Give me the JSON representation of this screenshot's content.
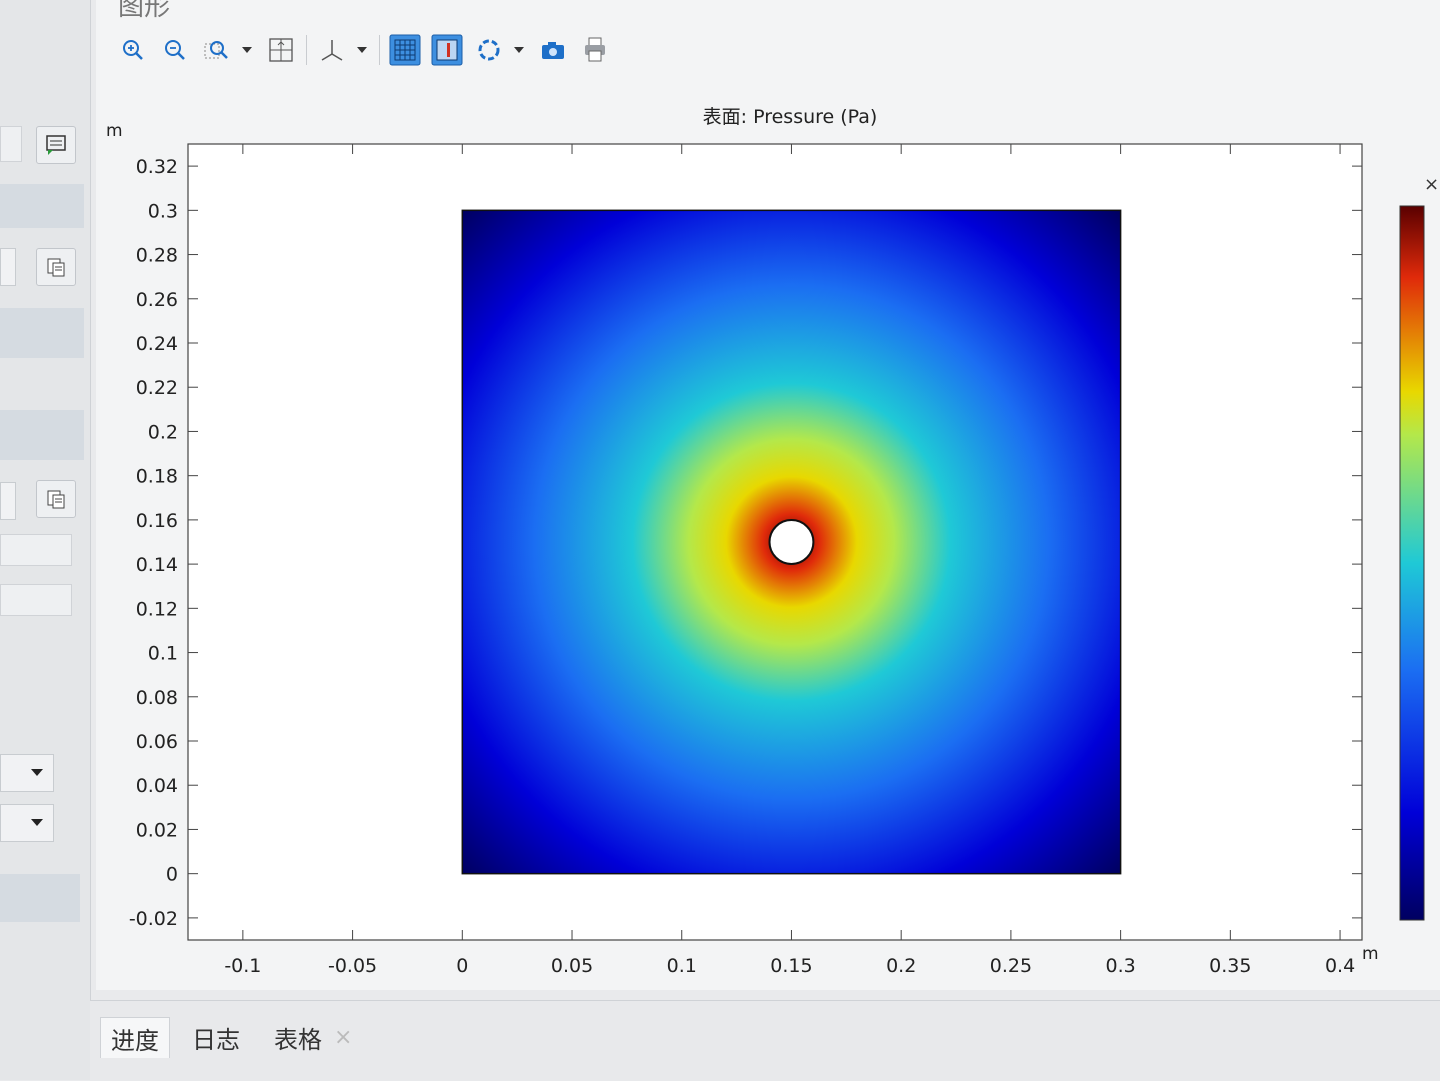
{
  "window": {
    "title": "图形"
  },
  "toolbar": {
    "icons": [
      "zoom-in-icon",
      "zoom-out-icon",
      "zoom-box-icon",
      "zoom-extents-icon",
      "axis-icon",
      "grid-icon",
      "colorbar-icon",
      "rotate-icon",
      "camera-icon",
      "print-icon"
    ]
  },
  "plot": {
    "title": "表面: Pressure (Pa)",
    "close_glyph": "×"
  },
  "chart_data": {
    "type": "heatmap",
    "title": "表面: Pressure (Pa)",
    "xlabel": "m",
    "ylabel": "m",
    "x_ticks": [
      "-0.1",
      "-0.05",
      "0",
      "0.05",
      "0.1",
      "0.15",
      "0.2",
      "0.25",
      "0.3",
      "0.35",
      "0.4"
    ],
    "y_ticks": [
      "0.32",
      "0.3",
      "0.28",
      "0.26",
      "0.24",
      "0.22",
      "0.2",
      "0.18",
      "0.16",
      "0.14",
      "0.12",
      "0.1",
      "0.08",
      "0.06",
      "0.04",
      "0.02",
      "0",
      "-0.02"
    ],
    "xlim": [
      -0.125,
      0.41
    ],
    "ylim": [
      -0.03,
      0.33
    ],
    "domain": {
      "x": [
        0,
        0.3
      ],
      "y": [
        0,
        0.3
      ]
    },
    "source": {
      "x": 0.15,
      "y": 0.15,
      "radius": 0.01
    },
    "colormap": [
      "#000060",
      "#0000d8",
      "#1b6ef2",
      "#1fc9d6",
      "#b4e84a",
      "#e8d800",
      "#e02a0a",
      "#5a0000"
    ],
    "grid": false
  },
  "tabs": [
    {
      "label": "进度"
    },
    {
      "label": "日志"
    },
    {
      "label": "表格"
    }
  ],
  "tab_close_glyph": "×"
}
